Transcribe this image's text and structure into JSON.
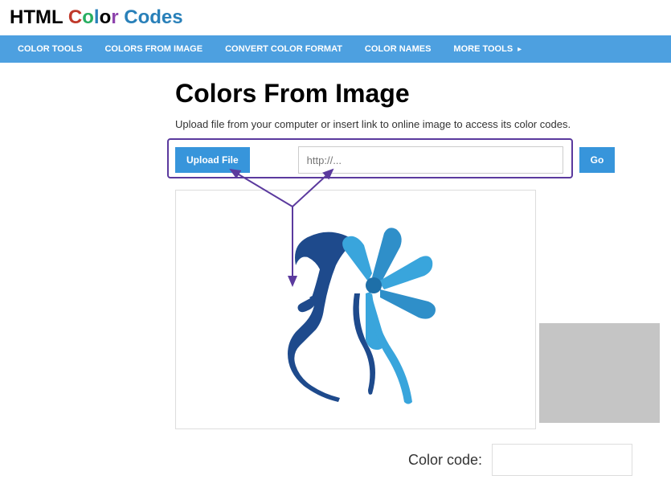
{
  "logo": {
    "word1": "HTML",
    "word2_chars": [
      "C",
      "o",
      "l",
      "o",
      "r"
    ],
    "word3": "Codes"
  },
  "nav": {
    "items": [
      "COLOR TOOLS",
      "COLORS FROM IMAGE",
      "CONVERT COLOR FORMAT",
      "COLOR NAMES",
      "MORE TOOLS"
    ]
  },
  "page": {
    "title": "Colors From Image",
    "description": "Upload file from your computer or insert link to online image to access its color codes."
  },
  "upload": {
    "button_label": "Upload File",
    "url_placeholder": "http://...",
    "go_label": "Go"
  },
  "color_code": {
    "label": "Color code:",
    "value": ""
  }
}
